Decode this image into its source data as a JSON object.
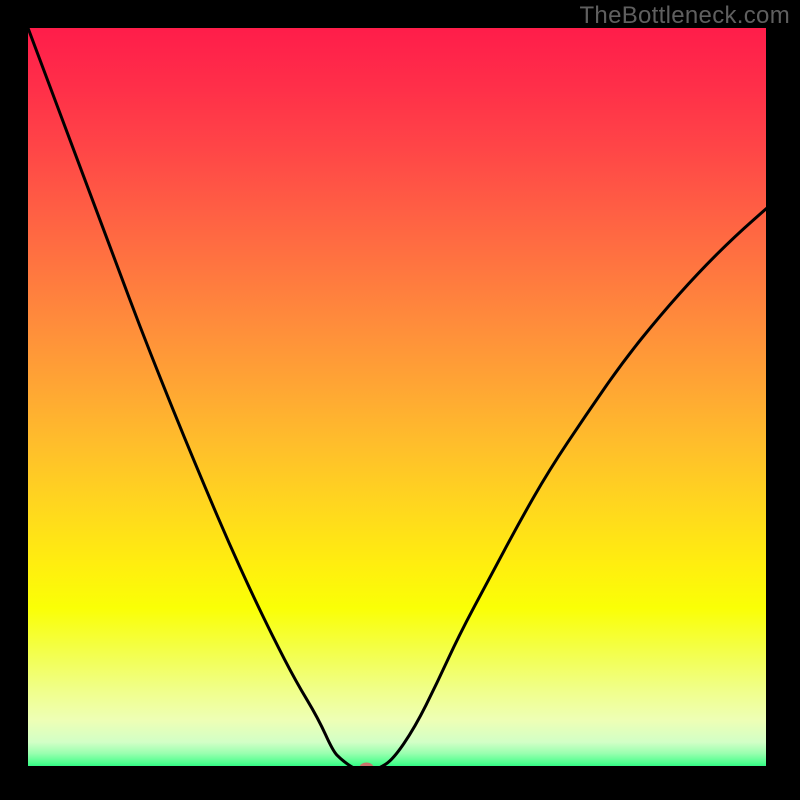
{
  "watermark": "TheBottleneck.com",
  "chart_data": {
    "type": "line",
    "title": "",
    "xlabel": "",
    "ylabel": "",
    "xlim": [
      0,
      1
    ],
    "ylim": [
      0,
      1
    ],
    "x": [
      0.0,
      0.03,
      0.06,
      0.09,
      0.12,
      0.15,
      0.18,
      0.21,
      0.24,
      0.27,
      0.3,
      0.33,
      0.36,
      0.39,
      0.41,
      0.42,
      0.43,
      0.44,
      0.45,
      0.455,
      0.46,
      0.47,
      0.49,
      0.52,
      0.55,
      0.58,
      0.62,
      0.66,
      0.7,
      0.75,
      0.8,
      0.85,
      0.9,
      0.95,
      1.0
    ],
    "values": [
      1.0,
      0.92,
      0.84,
      0.76,
      0.68,
      0.6,
      0.524,
      0.45,
      0.378,
      0.308,
      0.242,
      0.18,
      0.122,
      0.072,
      0.028,
      0.018,
      0.01,
      0.004,
      0.0,
      0.0,
      0.001,
      0.004,
      0.016,
      0.06,
      0.12,
      0.185,
      0.26,
      0.335,
      0.405,
      0.48,
      0.552,
      0.614,
      0.67,
      0.72,
      0.764
    ],
    "marker": {
      "x": 0.455,
      "y": 0.006,
      "color": "#c9736c"
    },
    "gradient_stops": [
      {
        "offset": 0.0,
        "color": "#ff1d4a"
      },
      {
        "offset": 0.08,
        "color": "#ff2f49"
      },
      {
        "offset": 0.16,
        "color": "#ff4547"
      },
      {
        "offset": 0.24,
        "color": "#ff5d44"
      },
      {
        "offset": 0.32,
        "color": "#ff7540"
      },
      {
        "offset": 0.4,
        "color": "#ff8d3b"
      },
      {
        "offset": 0.48,
        "color": "#ffa534"
      },
      {
        "offset": 0.56,
        "color": "#ffbe2b"
      },
      {
        "offset": 0.64,
        "color": "#ffd61f"
      },
      {
        "offset": 0.72,
        "color": "#ffee0f"
      },
      {
        "offset": 0.78,
        "color": "#faff06"
      },
      {
        "offset": 0.84,
        "color": "#f3ff4d"
      },
      {
        "offset": 0.89,
        "color": "#f0ff8a"
      },
      {
        "offset": 0.93,
        "color": "#eeffb5"
      },
      {
        "offset": 0.96,
        "color": "#d2ffc6"
      },
      {
        "offset": 0.975,
        "color": "#99ffaf"
      },
      {
        "offset": 0.988,
        "color": "#4dff8e"
      },
      {
        "offset": 1.0,
        "color": "#00e874"
      }
    ]
  }
}
